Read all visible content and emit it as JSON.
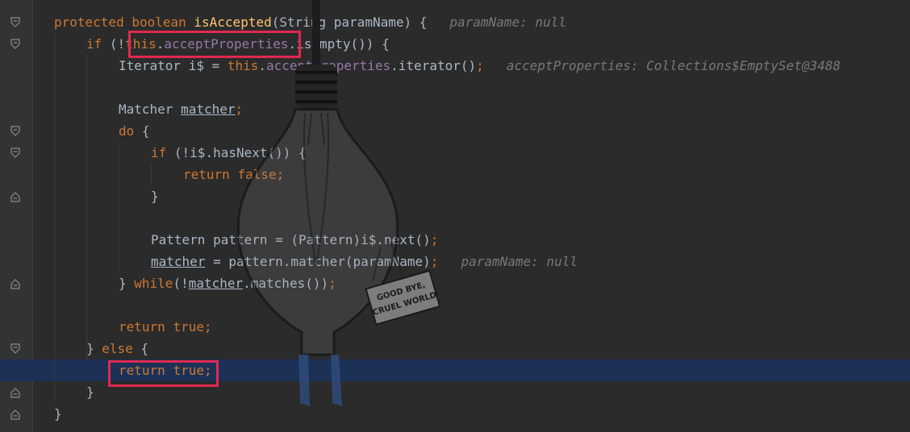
{
  "editor": {
    "lines": [
      {
        "indent": 0,
        "tokens": [
          {
            "t": "protected ",
            "c": "kw"
          },
          {
            "t": "boolean ",
            "c": "kw"
          },
          {
            "t": "isAccepted",
            "c": "fn"
          },
          {
            "t": "(String paramName) {",
            "c": ""
          }
        ],
        "hint": "paramName: null"
      },
      {
        "indent": 1,
        "tokens": [
          {
            "t": "if ",
            "c": "kw"
          },
          {
            "t": "(!",
            "c": ""
          },
          {
            "t": "this",
            "c": "kw"
          },
          {
            "t": ".",
            "c": ""
          },
          {
            "t": "acceptProperties",
            "c": "fld"
          },
          {
            "t": ".isEmpty()) {",
            "c": ""
          }
        ]
      },
      {
        "indent": 2,
        "tokens": [
          {
            "t": "Iterator i$ = ",
            "c": ""
          },
          {
            "t": "this",
            "c": "kw"
          },
          {
            "t": ".",
            "c": ""
          },
          {
            "t": "acceptProperties",
            "c": "fld"
          },
          {
            "t": ".iterator()",
            "c": ""
          },
          {
            "t": ";",
            "c": "kw"
          }
        ],
        "hint": "acceptProperties: Collections$EmptySet@3488"
      },
      {
        "indent": 0,
        "tokens": []
      },
      {
        "indent": 2,
        "tokens": [
          {
            "t": "Matcher ",
            "c": ""
          },
          {
            "t": "matcher",
            "c": "ul"
          },
          {
            "t": ";",
            "c": "kw"
          }
        ]
      },
      {
        "indent": 2,
        "tokens": [
          {
            "t": "do ",
            "c": "kw"
          },
          {
            "t": "{",
            "c": ""
          }
        ]
      },
      {
        "indent": 3,
        "tokens": [
          {
            "t": "if ",
            "c": "kw"
          },
          {
            "t": "(!i$.hasNext()) {",
            "c": ""
          }
        ]
      },
      {
        "indent": 4,
        "tokens": [
          {
            "t": "return ",
            "c": "kw"
          },
          {
            "t": "false",
            "c": "kw"
          },
          {
            "t": ";",
            "c": "kw"
          }
        ]
      },
      {
        "indent": 3,
        "tokens": [
          {
            "t": "}",
            "c": ""
          }
        ]
      },
      {
        "indent": 0,
        "tokens": []
      },
      {
        "indent": 3,
        "tokens": [
          {
            "t": "Pattern pattern = (Pattern)i$.next()",
            "c": ""
          },
          {
            "t": ";",
            "c": "kw"
          }
        ]
      },
      {
        "indent": 3,
        "tokens": [
          {
            "t": "matcher",
            "c": "ul"
          },
          {
            "t": " = pattern.matcher(paramName)",
            "c": ""
          },
          {
            "t": ";",
            "c": "kw"
          }
        ],
        "hint": "paramName: null"
      },
      {
        "indent": 2,
        "tokens": [
          {
            "t": "} ",
            "c": ""
          },
          {
            "t": "while",
            "c": "kw"
          },
          {
            "t": "(!",
            "c": ""
          },
          {
            "t": "matcher",
            "c": "ul"
          },
          {
            "t": ".matches())",
            "c": ""
          },
          {
            "t": ";",
            "c": "kw"
          }
        ]
      },
      {
        "indent": 0,
        "tokens": []
      },
      {
        "indent": 2,
        "tokens": [
          {
            "t": "return ",
            "c": "kw"
          },
          {
            "t": "true",
            "c": "kw"
          },
          {
            "t": ";",
            "c": "kw"
          }
        ]
      },
      {
        "indent": 1,
        "tokens": [
          {
            "t": "} ",
            "c": ""
          },
          {
            "t": "else ",
            "c": "kw"
          },
          {
            "t": "{",
            "c": ""
          }
        ]
      },
      {
        "indent": 2,
        "tokens": [
          {
            "t": "return ",
            "c": "kw"
          },
          {
            "t": "true",
            "c": "kw"
          },
          {
            "t": ";",
            "c": "kw"
          }
        ],
        "highlight": true
      },
      {
        "indent": 1,
        "tokens": [
          {
            "t": "}",
            "c": ""
          }
        ]
      },
      {
        "indent": 0,
        "tokens": [
          {
            "t": "}",
            "c": ""
          }
        ]
      }
    ]
  },
  "watermark": {
    "sign_text_1": "GOOD BYE,",
    "sign_text_2": "CRUEL WORLD"
  },
  "colors": {
    "background": "#2b2b2b",
    "keyword": "#cc7832",
    "function": "#ffc66d",
    "field": "#9876aa",
    "hint": "#787878",
    "highlight": "#1d3157",
    "annotation_box": "#e0294f"
  },
  "gutter": {
    "fold_markers": [
      {
        "line": 0,
        "type": "fold-open-icon"
      },
      {
        "line": 1,
        "type": "fold-open-icon"
      },
      {
        "line": 5,
        "type": "fold-open-icon"
      },
      {
        "line": 6,
        "type": "fold-open-icon"
      },
      {
        "line": 8,
        "type": "fold-close-icon"
      },
      {
        "line": 12,
        "type": "fold-close-icon"
      },
      {
        "line": 15,
        "type": "fold-open-icon"
      },
      {
        "line": 17,
        "type": "fold-close-icon"
      },
      {
        "line": 18,
        "type": "fold-close-icon"
      }
    ]
  }
}
